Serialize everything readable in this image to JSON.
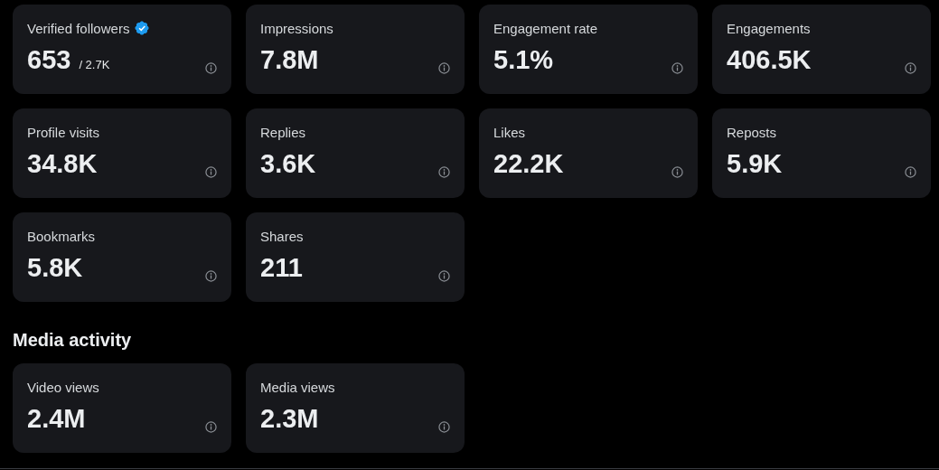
{
  "overview": {
    "metrics": [
      {
        "label": "Verified followers",
        "verified": true,
        "value": "653",
        "total": "/ 2.7K"
      },
      {
        "label": "Impressions",
        "verified": false,
        "value": "7.8M"
      },
      {
        "label": "Engagement rate",
        "verified": false,
        "value": "5.1%"
      },
      {
        "label": "Engagements",
        "verified": false,
        "value": "406.5K"
      },
      {
        "label": "Profile visits",
        "verified": false,
        "value": "34.8K"
      },
      {
        "label": "Replies",
        "verified": false,
        "value": "3.6K"
      },
      {
        "label": "Likes",
        "verified": false,
        "value": "22.2K"
      },
      {
        "label": "Reposts",
        "verified": false,
        "value": "5.9K"
      },
      {
        "label": "Bookmarks",
        "verified": false,
        "value": "5.8K"
      },
      {
        "label": "Shares",
        "verified": false,
        "value": "211"
      }
    ]
  },
  "media_activity": {
    "heading": "Media activity",
    "metrics": [
      {
        "label": "Video views",
        "verified": false,
        "value": "2.4M"
      },
      {
        "label": "Media views",
        "verified": false,
        "value": "2.3M"
      }
    ]
  }
}
